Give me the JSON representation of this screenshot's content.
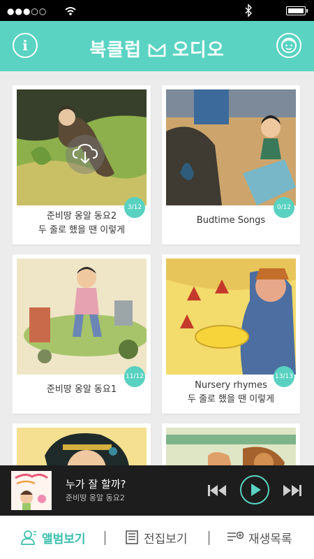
{
  "status_bar": {
    "signal": "●●●○○"
  },
  "header": {
    "title_left": "북클럽",
    "title_right": "오디오",
    "info_icon": "i"
  },
  "albums": [
    {
      "line1": "준비땅 옹알 동요2",
      "line2": "두 줄로 했을 땐 이렇게",
      "badge": "3/12",
      "downloadable": true
    },
    {
      "line1": "Budtime Songs",
      "line2": "",
      "badge": "0/12",
      "downloadable": false
    },
    {
      "line1": "준비땅 옹알 동요1",
      "line2": "",
      "badge": "11/12",
      "downloadable": false
    },
    {
      "line1": "Nursery rhymes",
      "line2": "두 줄로 했을 땐 이렇게",
      "badge": "13/13",
      "downloadable": false
    }
  ],
  "player": {
    "title": "누가 잘 할까?",
    "album": "준비땅 옹알 동요2"
  },
  "tabs": [
    {
      "label": "앨범보기",
      "icon": "album-person-icon",
      "active": true
    },
    {
      "label": "전집보기",
      "icon": "book-list-icon",
      "active": false
    },
    {
      "label": "재생목록",
      "icon": "playlist-add-icon",
      "active": false
    }
  ],
  "colors": {
    "accent": "#5ad3c3",
    "badge": "#59d1c1",
    "player_bg": "#1d1d1d"
  }
}
